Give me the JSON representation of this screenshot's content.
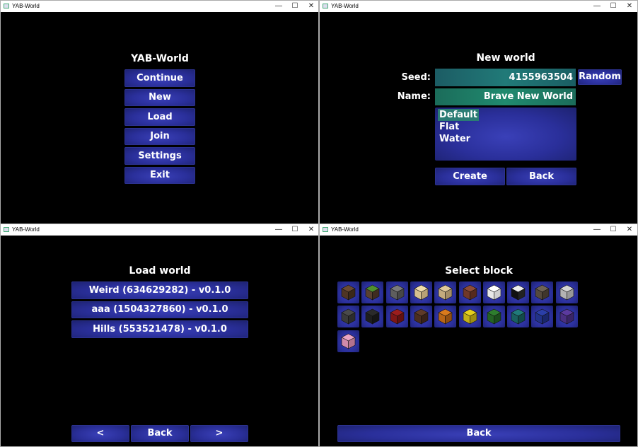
{
  "window_title": "YAB-World",
  "main_menu": {
    "title": "YAB-World",
    "buttons": [
      "Continue",
      "New",
      "Load",
      "Join",
      "Settings",
      "Exit"
    ]
  },
  "new_world": {
    "title": "New world",
    "seed_label": "Seed:",
    "seed_value": "4155963504",
    "random_label": "Random",
    "name_label": "Name:",
    "name_value": "Brave New World",
    "world_types": [
      "Default",
      "Flat",
      "Water"
    ],
    "selected_type": "Default",
    "create_label": "Create",
    "back_label": "Back"
  },
  "load_world": {
    "title": "Load world",
    "worlds": [
      "Weird (634629282) - v0.1.0",
      "aaa (1504327860) - v0.1.0",
      "Hills (553521478) - v0.1.0"
    ],
    "prev_label": "<",
    "back_label": "Back",
    "next_label": ">"
  },
  "select_block": {
    "title": "Select block",
    "back_label": "Back",
    "blocks": [
      {
        "name": "dirt-block-icon",
        "top": "#6b4a32",
        "left": "#4f3524",
        "right": "#3b2819"
      },
      {
        "name": "grass-block-icon",
        "top": "#4f8f2e",
        "left": "#5a4030",
        "right": "#3f2c20"
      },
      {
        "name": "stone-block-icon",
        "top": "#7a7a7a",
        "left": "#5e5e5e",
        "right": "#474747"
      },
      {
        "name": "sand-block-icon",
        "top": "#f0dcaa",
        "left": "#d6c090",
        "right": "#b8a276"
      },
      {
        "name": "sandstone-block-icon",
        "top": "#e0c89a",
        "left": "#c4ab7e",
        "right": "#a58e66"
      },
      {
        "name": "planks-block-icon",
        "top": "#8e4b36",
        "left": "#703828",
        "right": "#562a1d"
      },
      {
        "name": "snow-block-icon",
        "top": "#ffffff",
        "left": "#e8e8e8",
        "right": "#cfcfcf"
      },
      {
        "name": "glass-block-icon",
        "top": "#eeeeee",
        "left": "#111111",
        "right": "#222222"
      },
      {
        "name": "bricks-block-icon",
        "top": "#6e6254",
        "left": "#55493d",
        "right": "#40362c"
      },
      {
        "name": "iron-block-icon",
        "top": "#d4d4d4",
        "left": "#b3b3b3",
        "right": "#989898"
      },
      {
        "name": "gray-block-icon",
        "top": "#4a4a4a",
        "left": "#3a3a3a",
        "right": "#2c2c2c"
      },
      {
        "name": "black-block-icon",
        "top": "#2a2a2a",
        "left": "#1e1e1e",
        "right": "#151515"
      },
      {
        "name": "red-block-icon",
        "top": "#9b1d1d",
        "left": "#7e1616",
        "right": "#621010"
      },
      {
        "name": "brown-block-icon",
        "top": "#5e3a28",
        "left": "#4a2d1f",
        "right": "#382117"
      },
      {
        "name": "orange-block-icon",
        "top": "#d97a1d",
        "left": "#b86516",
        "right": "#944f10"
      },
      {
        "name": "yellow-block-icon",
        "top": "#e5cf1e",
        "left": "#c4b016",
        "right": "#9f8f10"
      },
      {
        "name": "green-block-icon",
        "top": "#2e7d2e",
        "left": "#246324",
        "right": "#1b4d1b"
      },
      {
        "name": "teal-block-icon",
        "top": "#207a7a",
        "left": "#196060",
        "right": "#124a4a"
      },
      {
        "name": "blue-block-icon",
        "top": "#2b3fa8",
        "left": "#223289",
        "right": "#1a276b"
      },
      {
        "name": "purple-block-icon",
        "top": "#5b3a9e",
        "left": "#4a2f82",
        "right": "#392466"
      },
      {
        "name": "pink-block-icon",
        "top": "#e9a3c4",
        "left": "#d08aab",
        "right": "#b3728f"
      }
    ]
  },
  "colors": {
    "button_bg": "#2a2f9a",
    "field_teal": "#1e6d6a",
    "field_green": "#1d7a66",
    "window_bg": "#000000"
  }
}
